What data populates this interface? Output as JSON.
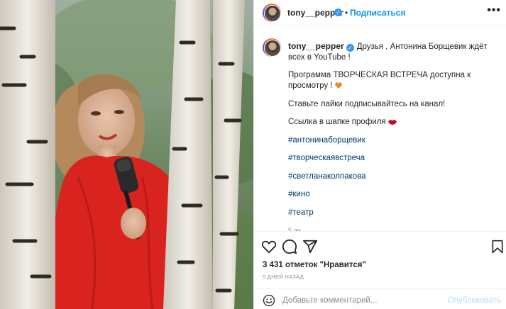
{
  "header": {
    "username": "tony__pepper",
    "follow_label": "Подписаться",
    "more_label": "•••",
    "dot": "•"
  },
  "caption": {
    "username": "tony__pepper",
    "text1": "Друзья , Антонина Борщевик ждёт всех в YouTube !",
    "text2": "Программа ТВОРЧЕСКАЯ ВСТРЕЧА доступна к просмотру !",
    "text3": "Ставьте лайки подписывайтесь на канал!",
    "text4": "Ссылка в шапке профиля",
    "hashtags": [
      "#антонинаборщевик",
      "#творческаявстреча",
      "#светланаколпакова",
      "#кино",
      "#театр"
    ],
    "ago": "5 дн."
  },
  "stats": {
    "likes": "3 431 отметок \"Нравится\"",
    "date": "5 ДНЕЙ НАЗАД"
  },
  "comment_box": {
    "placeholder": "Добавьте комментарий...",
    "post_label": "Опубликовать"
  },
  "icons": {
    "like": "heart-icon",
    "comment": "comment-icon",
    "share": "paper-plane-icon",
    "save": "bookmark-icon",
    "emoji": "smiley-icon",
    "verified": "verified-badge-icon"
  },
  "colors": {
    "accent": "#0095f6",
    "link": "#00376b",
    "muted": "#8e8e8e",
    "verified": "#3897f0"
  }
}
